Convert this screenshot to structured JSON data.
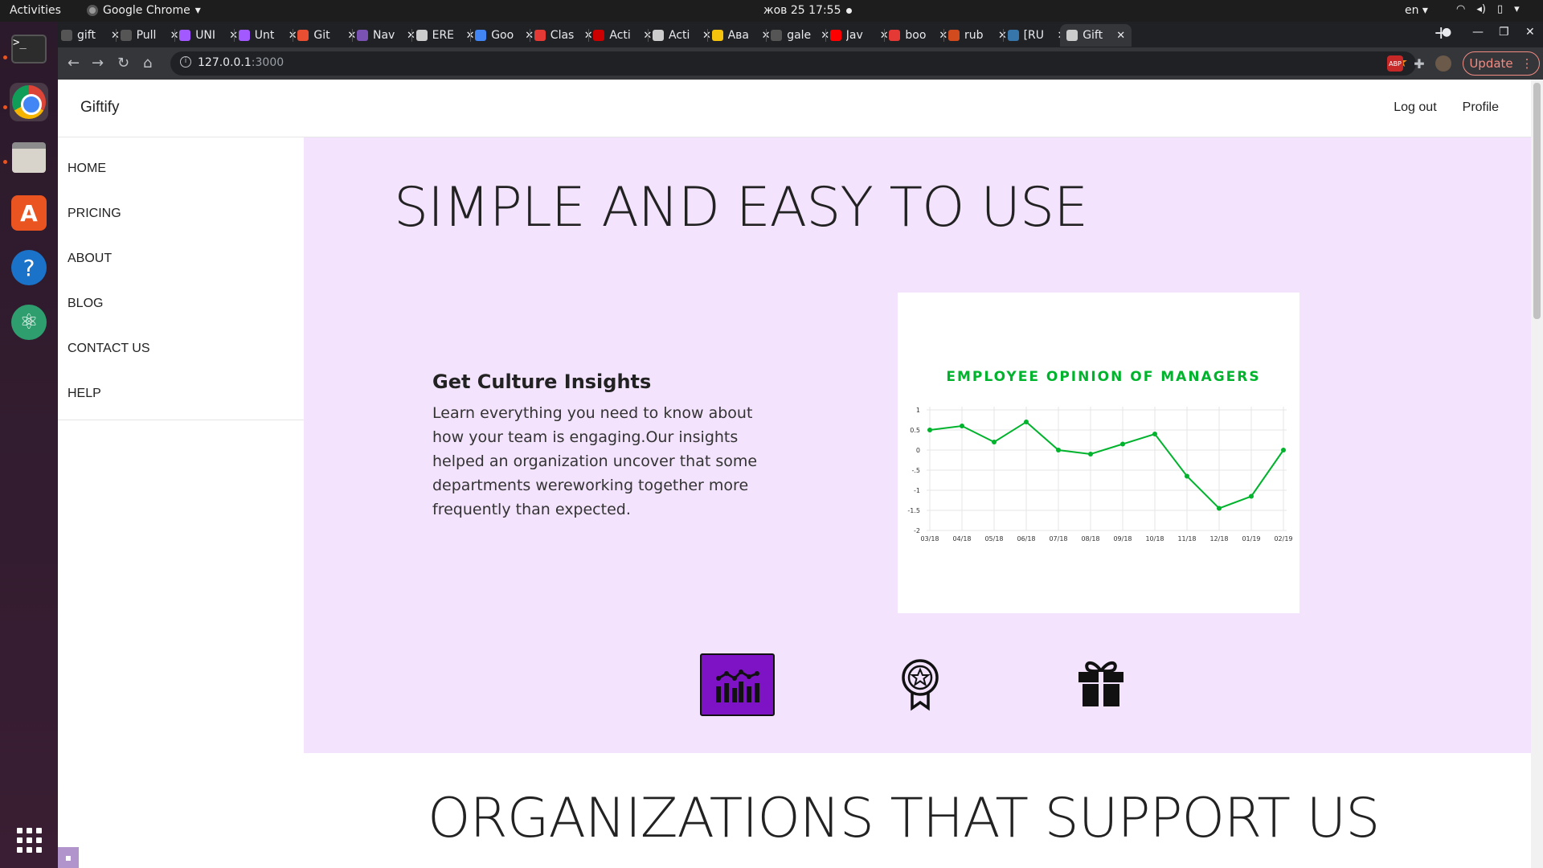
{
  "system": {
    "activities": "Activities",
    "app_name": "Google Chrome",
    "app_caret": "▾",
    "clock": "жов 25  17:55",
    "lang": "en ▾",
    "icons": [
      "wifi-icon",
      "volume-icon",
      "battery-icon",
      "power-menu-icon"
    ]
  },
  "dock": {
    "items": [
      "terminal",
      "google-chrome",
      "files",
      "ubuntu-software",
      "help",
      "atom"
    ],
    "terminal_glyph": ">_",
    "store_glyph": "A",
    "help_glyph": "?",
    "atom_glyph": "⚛"
  },
  "browser": {
    "tabs": [
      {
        "title": "gift",
        "color": "#555555"
      },
      {
        "title": "Pull",
        "color": "#555555"
      },
      {
        "title": "UNI",
        "color": "#a259ff"
      },
      {
        "title": "Unt",
        "color": "#a259ff"
      },
      {
        "title": "Git",
        "color": "#e84e31"
      },
      {
        "title": "Nav",
        "color": "#7952b3"
      },
      {
        "title": "ERE",
        "color": "#cccccc"
      },
      {
        "title": "Goo",
        "color": "#4285f4"
      },
      {
        "title": "Clas",
        "color": "#e53935"
      },
      {
        "title": "Acti",
        "color": "#cc0000"
      },
      {
        "title": "Acti",
        "color": "#cccccc"
      },
      {
        "title": "Ава",
        "color": "#f4c20d"
      },
      {
        "title": "gale",
        "color": "#555555"
      },
      {
        "title": "Jav",
        "color": "#ff0000"
      },
      {
        "title": "boo",
        "color": "#e53935"
      },
      {
        "title": "rub",
        "color": "#d24b1f"
      },
      {
        "title": "[RU",
        "color": "#3776ab"
      },
      {
        "title": "Gift",
        "color": "#cccccc",
        "active": true
      }
    ],
    "close_glyph": "✕",
    "new_tab": "+",
    "url_host": "127.0.0.1",
    "url_port": ":3000",
    "update_label": "Update",
    "update_menu": "⋮",
    "ext_abp": "ABP"
  },
  "navbar": {
    "brand": "Giftify",
    "links": [
      "Log out",
      "Profile"
    ]
  },
  "sidebar": {
    "items": [
      "HOME",
      "PRICING",
      "ABOUT",
      "BLOG",
      "CONTACT US",
      "HELP"
    ]
  },
  "hero": {
    "title": "SIMPLE AND EASY TO USE",
    "feature_heading": "Get Culture Insights",
    "feature_text": "Learn everything you need to know about how your team is engaging.Our insights helped an organization uncover that some departments wereworking together more frequently than expected.",
    "icons": [
      "analytics-chart-icon",
      "award-badge-icon",
      "gift-icon"
    ]
  },
  "section2": {
    "title": "ORGANIZATIONS THAT SUPPORT US"
  },
  "chart_data": {
    "type": "line",
    "title": "EMPLOYEE OPINION  OF MANAGERS",
    "xlabel": "",
    "ylabel": "",
    "categories": [
      "03/18",
      "04/18",
      "05/18",
      "06/18",
      "07/18",
      "08/18",
      "09/18",
      "10/18",
      "11/18",
      "12/18",
      "01/19",
      "02/19"
    ],
    "values": [
      0.5,
      0.6,
      0.2,
      0.7,
      0.0,
      -0.1,
      0.15,
      0.4,
      -0.65,
      -1.45,
      -1.15,
      0.0
    ],
    "ylim": [
      -2,
      1
    ],
    "yticks": [
      "1",
      "0.5",
      "0",
      "-.5",
      "-1",
      "-1.5",
      "-2"
    ],
    "ytick_values": [
      1,
      0.5,
      0,
      -0.5,
      -1,
      -1.5,
      -2
    ],
    "grid": true,
    "line_color": "#00b32c",
    "title_color": "#00b32c"
  },
  "colors": {
    "hero_bg": "#f3e3fd",
    "accent_purple": "#7e13c6"
  }
}
